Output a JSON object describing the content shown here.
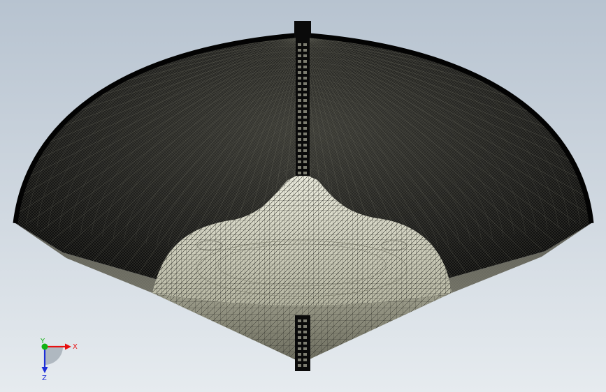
{
  "viewport": {
    "background_top": "#b7c3d0",
    "background_bottom": "#e6ebef"
  },
  "mesh": {
    "dark_color": "#121212",
    "mid_color": "#3a3a34",
    "light_color": "#d2d2c0",
    "pale_color": "#e4e4d6",
    "shaft_color": "#0a0a0a"
  },
  "triad": {
    "x_label": "X",
    "y_label": "Y",
    "z_label": "Z",
    "x_color": "#e81010",
    "y_color": "#12b312",
    "z_color": "#1d2ed8"
  }
}
